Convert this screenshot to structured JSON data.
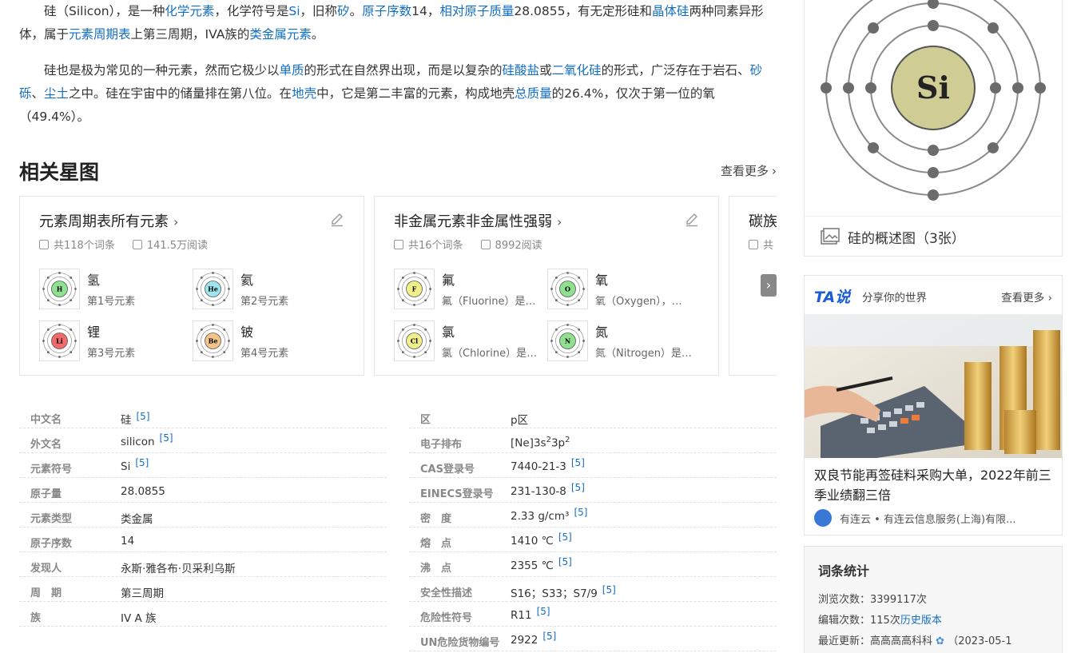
{
  "intro": {
    "p1": [
      {
        "t": "硅（Silicon），是一种"
      },
      {
        "t": "化学元素",
        "link": true
      },
      {
        "t": "，化学符号是"
      },
      {
        "t": "Si",
        "link": true
      },
      {
        "t": "，旧称"
      },
      {
        "t": "矽",
        "link": true
      },
      {
        "t": "。"
      },
      {
        "t": "原子序数",
        "link": true
      },
      {
        "t": "14，"
      },
      {
        "t": "相对原子质量",
        "link": true
      },
      {
        "t": "28.0855，有无定形硅和"
      },
      {
        "t": "晶体硅",
        "link": true
      },
      {
        "t": "两种同素异形体，属于"
      },
      {
        "t": "元素周期表",
        "link": true
      },
      {
        "t": "上第三周期，IVA族的"
      },
      {
        "t": "类金属元素",
        "link": true
      },
      {
        "t": "。"
      }
    ],
    "p2": [
      {
        "t": "硅也是极为常见的一种元素，然而它极少以"
      },
      {
        "t": "单质",
        "link": true
      },
      {
        "t": "的形式在自然界出现，而是以复杂的"
      },
      {
        "t": "硅酸盐",
        "link": true
      },
      {
        "t": "或"
      },
      {
        "t": "二氧化硅",
        "link": true
      },
      {
        "t": "的形式，广泛存在于岩石、"
      },
      {
        "t": "砂砾",
        "link": true
      },
      {
        "t": "、"
      },
      {
        "t": "尘土",
        "link": true
      },
      {
        "t": "之中。硅在宇宙中的储量排在第八位。在"
      },
      {
        "t": "地壳",
        "link": true
      },
      {
        "t": "中，它是第二丰富的元素，构成地壳"
      },
      {
        "t": "总质量",
        "link": true
      },
      {
        "t": "的26.4%，仅次于第一位的氧（49.4%）。"
      }
    ]
  },
  "section": {
    "title": "相关星图",
    "more": "查看更多"
  },
  "cards": [
    {
      "title": "元素周期表所有元素",
      "entries": "共118个词条",
      "reads": "141.5万阅读",
      "items": [
        {
          "name": "氢",
          "desc": "第1号元素",
          "sym": "H",
          "color": "#8fe08f"
        },
        {
          "name": "氦",
          "desc": "第2号元素",
          "sym": "He",
          "color": "#9fe7ef"
        },
        {
          "name": "锂",
          "desc": "第3号元素",
          "sym": "Li",
          "color": "#f26a6a"
        },
        {
          "name": "铍",
          "desc": "第4号元素",
          "sym": "Be",
          "color": "#f3c38a"
        }
      ]
    },
    {
      "title": "非金属元素非金属性强弱",
      "entries": "共16个词条",
      "reads": "8992阅读",
      "items": [
        {
          "name": "氟",
          "desc": "氟（Fluorine）是…",
          "sym": "F",
          "color": "#f0ef8a"
        },
        {
          "name": "氧",
          "desc": "氧（Oxygen），…",
          "sym": "O",
          "color": "#8fe08f"
        },
        {
          "name": "氯",
          "desc": "氯（Chlorine）是…",
          "sym": "Cl",
          "color": "#f0ef8a"
        },
        {
          "name": "氮",
          "desc": "氮（Nitrogen）是…",
          "sym": "N",
          "color": "#8fe08f"
        }
      ]
    },
    {
      "title": "碳族",
      "entries": "共",
      "reads": ""
    }
  ],
  "info_left": [
    {
      "k": "中文名",
      "v": "硅",
      "ref": "[5]"
    },
    {
      "k": "外文名",
      "v": "silicon",
      "ref": "[5]"
    },
    {
      "k": "元素符号",
      "v": "Si",
      "ref": "[5]"
    },
    {
      "k": "原子量",
      "v": "28.0855",
      "ref": ""
    },
    {
      "k": "元素类型",
      "v": "类金属",
      "ref": ""
    },
    {
      "k": "原子序数",
      "v": "14",
      "ref": ""
    },
    {
      "k": "发现人",
      "v": "永斯·雅各布·贝采利乌斯",
      "ref": ""
    },
    {
      "k": "周　期",
      "v": "第三周期",
      "ref": ""
    },
    {
      "k": "族",
      "v": "IV A 族",
      "ref": ""
    }
  ],
  "info_right": [
    {
      "k": "区",
      "v": "p区",
      "ref": ""
    },
    {
      "k": "电子排布",
      "v": "[Ne]3s",
      "sup1": "2",
      "v2": "3p",
      "sup2": "2",
      "ref": ""
    },
    {
      "k": "CAS登录号",
      "v": "7440-21-3",
      "ref": "[5]"
    },
    {
      "k": "EINECS登录号",
      "v": "231-130-8",
      "ref": "[5]"
    },
    {
      "k": "密　度",
      "v": "2.33 g/cm³",
      "ref": "[5]"
    },
    {
      "k": "熔　点",
      "v": "1410 ℃",
      "ref": "[5]"
    },
    {
      "k": "沸　点",
      "v": "2355 ℃",
      "ref": "[5]"
    },
    {
      "k": "安全性描述",
      "v": "S16；S33；S7/9",
      "ref": "[5]"
    },
    {
      "k": "危险性符号",
      "v": "R11",
      "ref": "[5]"
    },
    {
      "k": "UN危险货物编号",
      "v": "2922",
      "ref": "[5]"
    }
  ],
  "atom": {
    "symbol": "Si",
    "caption": "硅的概述图（3张）",
    "nucleus_color": "#cfcc94"
  },
  "ta": {
    "logo": "TA说",
    "slogan": "分享你的世界",
    "more": "查看更多",
    "headline": "双良节能再签硅料采购大单，2022年前三季业绩翻三倍",
    "source": "有连云 • 有连云信息服务(上海)有限..."
  },
  "stats": {
    "title": "词条统计",
    "views_label": "浏览次数：",
    "views": "3399117次",
    "edits_label": "编辑次数：",
    "edits": "115次",
    "history": "历史版本",
    "updated_label": "最近更新：",
    "updater": "高高高高科科",
    "date": "（2023-05-1"
  }
}
